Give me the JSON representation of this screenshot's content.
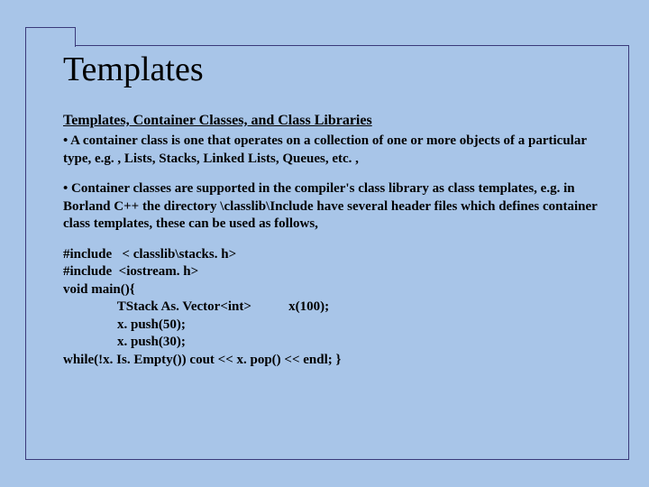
{
  "title": "Templates",
  "subtitle": "Templates, Container Classes, and Class Libraries",
  "bullet1": "• A container class is one that operates on a collection of one or more objects of a particular type, e.g. , Lists, Stacks, Linked Lists, Queues, etc. ,",
  "bullet2": "• Container classes are supported in the compiler's class library as class templates, e.g. in Borland C++ the directory \\classlib\\Include  have several header files which defines container class templates, these can be used as follows,",
  "code": "#include   < classlib\\stacks. h>\n#include  <iostream. h>\nvoid main(){\n                TStack As. Vector<int>           x(100);\n                x. push(50);\n                x. push(30);\nwhile(!x. Is. Empty()) cout << x. pop() << endl; }"
}
